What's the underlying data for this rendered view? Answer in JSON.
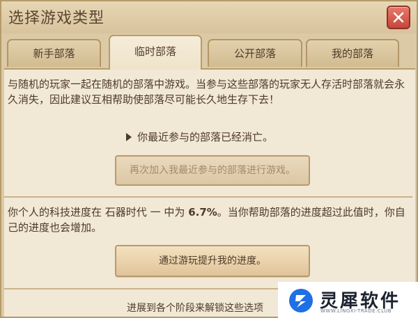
{
  "window": {
    "title": "选择游戏类型"
  },
  "tabs": [
    {
      "label": "新手部落",
      "active": false
    },
    {
      "label": "临时部落",
      "active": true
    },
    {
      "label": "公开部落",
      "active": false
    },
    {
      "label": "我的部落",
      "active": false
    }
  ],
  "content": {
    "description": "与随机的玩家一起在随机的部落中游戏。当参与这些部落的玩家无人存活时部落就会永久消失，因此建议互相帮助使部落尽可能长久地生存下去！",
    "notice": "你最近参与的部落已经消亡。",
    "rejoin_button": "再次加入我最近参与的部落进行游戏。",
    "progress_prefix": "你个人的科技进度在",
    "progress_era": "石器时代",
    "progress_dash": "一",
    "progress_mid": "中为",
    "progress_value": "6.7%",
    "progress_suffix": "。当你帮助部落的进度超过此值时，你自己的进度也会增加。",
    "improve_button": "通过游玩提升我的进度。",
    "footer_text": "进展到各个阶段来解锁这些选项"
  },
  "watermark": {
    "name": "灵犀软件",
    "domain": "WWW.LINGXI-TRADE.CLUB"
  },
  "colors": {
    "panel_bg": "#f2e8d6",
    "frame_bg": "#dccaa6",
    "text": "#4d3a28",
    "close_red": "#c7463b",
    "brand_blue": "#1f6fe5"
  }
}
